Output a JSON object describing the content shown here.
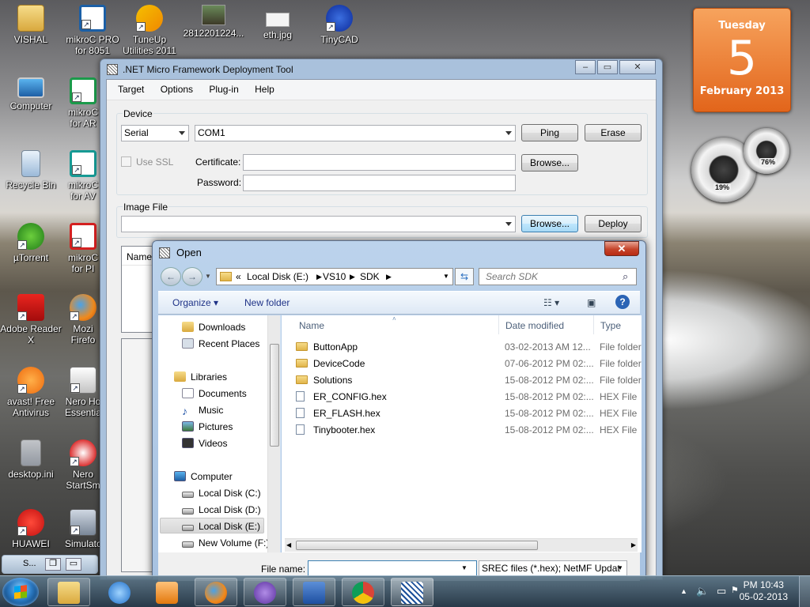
{
  "desktop": {
    "icons": [
      {
        "label": "VISHAL",
        "icon": "folder-icon"
      },
      {
        "label": "mikroC PRO for 8051",
        "icon": "mikroc-icon"
      },
      {
        "label": "TuneUp Utilities 2011",
        "icon": "tuneup-icon"
      },
      {
        "label": "2812201224...",
        "icon": "image-file-icon"
      },
      {
        "label": "eth.jpg",
        "icon": "image-file-icon"
      },
      {
        "label": "TinyCAD",
        "icon": "tinycad-icon"
      },
      {
        "label": "Computer",
        "icon": "computer-icon"
      },
      {
        "label": "mikroC for AR",
        "icon": "mikroc-icon"
      },
      {
        "label": "Recycle Bin",
        "icon": "recycle-bin-icon"
      },
      {
        "label": "mikroC for AV",
        "icon": "mikroc-icon"
      },
      {
        "label": "µTorrent",
        "icon": "utorrent-icon"
      },
      {
        "label": "mikroC for PI",
        "icon": "mikroc-icon"
      },
      {
        "label": "Adobe Reader X",
        "icon": "adobe-reader-icon"
      },
      {
        "label": "Mozi Firefo",
        "icon": "firefox-icon"
      },
      {
        "label": "avast! Free Antivirus",
        "icon": "avast-icon"
      },
      {
        "label": "Nero Ho Essentia",
        "icon": "nero-icon"
      },
      {
        "label": "desktop.ini",
        "icon": "ini-file-icon"
      },
      {
        "label": "Nero StartSm",
        "icon": "nero-icon"
      },
      {
        "label": "HUAWEI",
        "icon": "huawei-icon"
      },
      {
        "label": "Simulato",
        "icon": "simulator-icon"
      }
    ]
  },
  "gadgets": {
    "calendar": {
      "day": "Tuesday",
      "date": "5",
      "month_year": "February 2013",
      "color": "#e8742a"
    },
    "cpu_meter": {
      "cpu": "19%",
      "memory": "76%"
    }
  },
  "mini_window": {
    "label": "S..."
  },
  "deploy_tool": {
    "title": ".NET Micro Framework Deployment Tool",
    "menu": [
      "Target",
      "Options",
      "Plug-in",
      "Help"
    ],
    "device_group": "Device",
    "transport": "Serial",
    "port": "COM1",
    "ping": "Ping",
    "erase": "Erase",
    "use_ssl": "Use SSL",
    "certificate_label": "Certificate:",
    "password_label": "Password:",
    "browse": "Browse...",
    "image_group": "Image File",
    "image_browse": "Browse...",
    "deploy": "Deploy",
    "list_header": "Name"
  },
  "open_dialog": {
    "title": "Open",
    "address": {
      "root": "«",
      "parts": [
        "Local Disk (E:)",
        "VS10",
        "SDK"
      ]
    },
    "search_placeholder": "Search SDK",
    "organize": "Organize",
    "new_folder": "New folder",
    "nav": {
      "favorites": [
        "Downloads",
        "Recent Places"
      ],
      "libraries_label": "Libraries",
      "libraries": [
        "Documents",
        "Music",
        "Pictures",
        "Videos"
      ],
      "computer_label": "Computer",
      "drives": [
        "Local Disk (C:)",
        "Local Disk (D:)",
        "Local Disk (E:)",
        "New Volume (F:)"
      ],
      "selected": "Local Disk (E:)"
    },
    "columns": [
      "Name",
      "Date modified",
      "Type"
    ],
    "files": [
      {
        "name": "ButtonApp",
        "date": "03-02-2013 AM 12...",
        "type": "File folder",
        "kind": "folder"
      },
      {
        "name": "DeviceCode",
        "date": "07-06-2012 PM 02:...",
        "type": "File folder",
        "kind": "folder"
      },
      {
        "name": "Solutions",
        "date": "15-08-2012 PM 02:...",
        "type": "File folder",
        "kind": "folder"
      },
      {
        "name": "ER_CONFIG.hex",
        "date": "15-08-2012 PM 02:...",
        "type": "HEX File",
        "kind": "hex"
      },
      {
        "name": "ER_FLASH.hex",
        "date": "15-08-2012 PM 02:...",
        "type": "HEX File",
        "kind": "hex"
      },
      {
        "name": "Tinybooter.hex",
        "date": "15-08-2012 PM 02:...",
        "type": "HEX File",
        "kind": "hex"
      }
    ],
    "file_name_label": "File name:",
    "file_name_value": "",
    "filter": "SREC files (*.hex); NetMF Updat"
  },
  "taskbar": {
    "apps": [
      "explorer-icon",
      "internet-explorer-icon",
      "media-player-icon",
      "firefox-icon",
      "visual-studio-icon",
      "word-icon",
      "chrome-icon",
      "mfdeploy-icon"
    ],
    "time": "PM 10:43",
    "date": "05-02-2013"
  }
}
